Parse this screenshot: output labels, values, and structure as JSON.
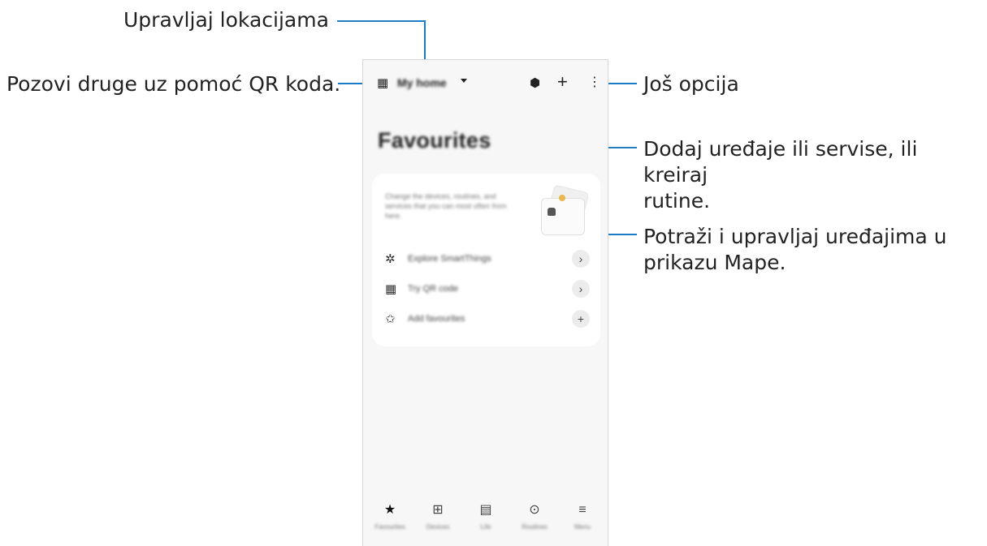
{
  "callouts": {
    "manage_locations": "Upravljaj lokacijama",
    "invite_qr": "Pozovi druge uz pomoć QR koda.",
    "more_options": "Još opcija",
    "add_devices_line1": "Dodaj uređaje ili servise, ili kreiraj",
    "add_devices_line2": "rutine.",
    "map_view_line1": "Potraži i upravljaj uređajima u",
    "map_view_line2": "prikazu Mape."
  },
  "phone": {
    "location_name": "My home",
    "page_title": "Favourites",
    "card_description": "Change the devices, routines, and services that you can most often from here.",
    "rows": [
      {
        "label": "Explore SmartThings",
        "icon": "smartthings-icon",
        "glyph": "✲",
        "button": "›"
      },
      {
        "label": "Try QR code",
        "icon": "qr-code-icon",
        "glyph": "▦",
        "button": "›"
      },
      {
        "label": "Add favourites",
        "icon": "star-outline-icon",
        "glyph": "✩",
        "button": "+"
      }
    ],
    "nav": [
      {
        "label": "Favourites",
        "icon": "star-icon",
        "glyph": "★"
      },
      {
        "label": "Devices",
        "icon": "devices-grid-icon",
        "glyph": "⊞"
      },
      {
        "label": "Life",
        "icon": "life-icon",
        "glyph": "▤"
      },
      {
        "label": "Routines",
        "icon": "routines-icon",
        "glyph": "⊙"
      },
      {
        "label": "Menu",
        "icon": "menu-icon",
        "glyph": "≡"
      }
    ],
    "top_icons": {
      "qr": "▦",
      "map": "⬢",
      "add": "+",
      "more": "⋮"
    }
  },
  "colors": {
    "accent": "#1e7cc4"
  }
}
